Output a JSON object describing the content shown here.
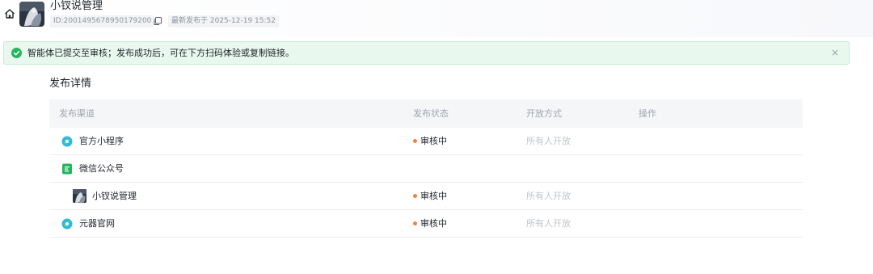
{
  "header": {
    "title": "小钗说管理",
    "id_text": "ID:2001495678950179200",
    "published_text": "最新发布于 2025-12-19 15:52"
  },
  "alert": {
    "message": "智能体已提交至审核；发布成功后，可在下方扫码体验或复制链接。",
    "close_glyph": "×"
  },
  "section": {
    "title": "发布详情"
  },
  "table": {
    "columns": [
      "发布渠道",
      "发布状态",
      "开放方式",
      "操作"
    ],
    "rows": [
      {
        "channel": "官方小程序",
        "icon": "mini-program-icon",
        "status": "审核中",
        "open_mode": "所有人开放",
        "indent": false
      },
      {
        "channel": "微信公众号",
        "icon": "wechat-official-account-icon",
        "status": "",
        "open_mode": "",
        "indent": false
      },
      {
        "channel": "小钗说管理",
        "icon": "agent-avatar-icon",
        "status": "审核中",
        "open_mode": "所有人开放",
        "indent": true
      },
      {
        "channel": "元器官网",
        "icon": "yuanqi-site-icon",
        "status": "审核中",
        "open_mode": "所有人开放",
        "indent": false
      }
    ]
  },
  "colors": {
    "success": "#27b45e",
    "status_dot": "#f5803e",
    "muted_text": "#c0c4cc",
    "alert_bg": "#e9f8ef"
  }
}
